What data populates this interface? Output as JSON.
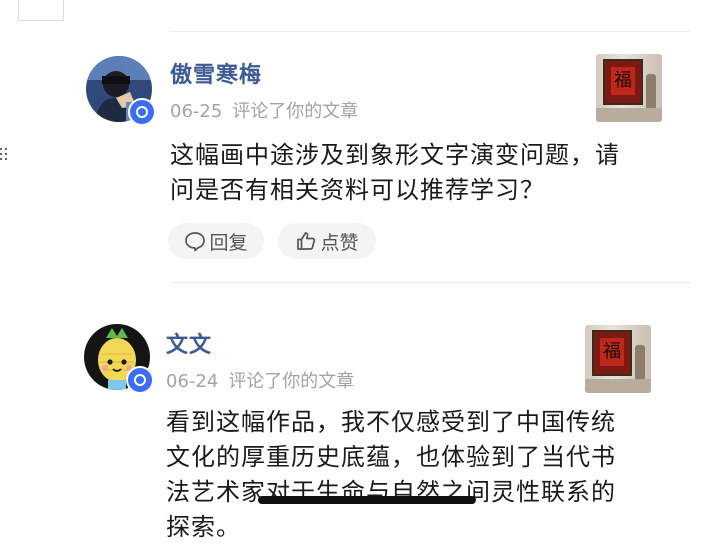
{
  "comments": [
    {
      "username": "傲雪寒梅",
      "date": "06-25",
      "action": "评论了你的文章",
      "content_lines": [
        "这幅画中途涉及到象形文字演变问题，请",
        "问是否有相关资料可以推荐学习？"
      ],
      "reply_label": "回复",
      "like_label": "点赞",
      "thumb_char": "福"
    },
    {
      "username": "文文",
      "date": "06-24",
      "action": "评论了你的文章",
      "content_lines": [
        "看到这幅作品，我不仅感受到了中国传统",
        "文化的厚重历史底蕴，也体验到了当代书",
        "法艺术家对于生命与自然之间灵性联系的",
        "探索。"
      ],
      "thumb_char": "福"
    }
  ],
  "colors": {
    "username": "#3d5a94",
    "badge": "#3b6ef5",
    "meta": "#a3a3a3"
  }
}
